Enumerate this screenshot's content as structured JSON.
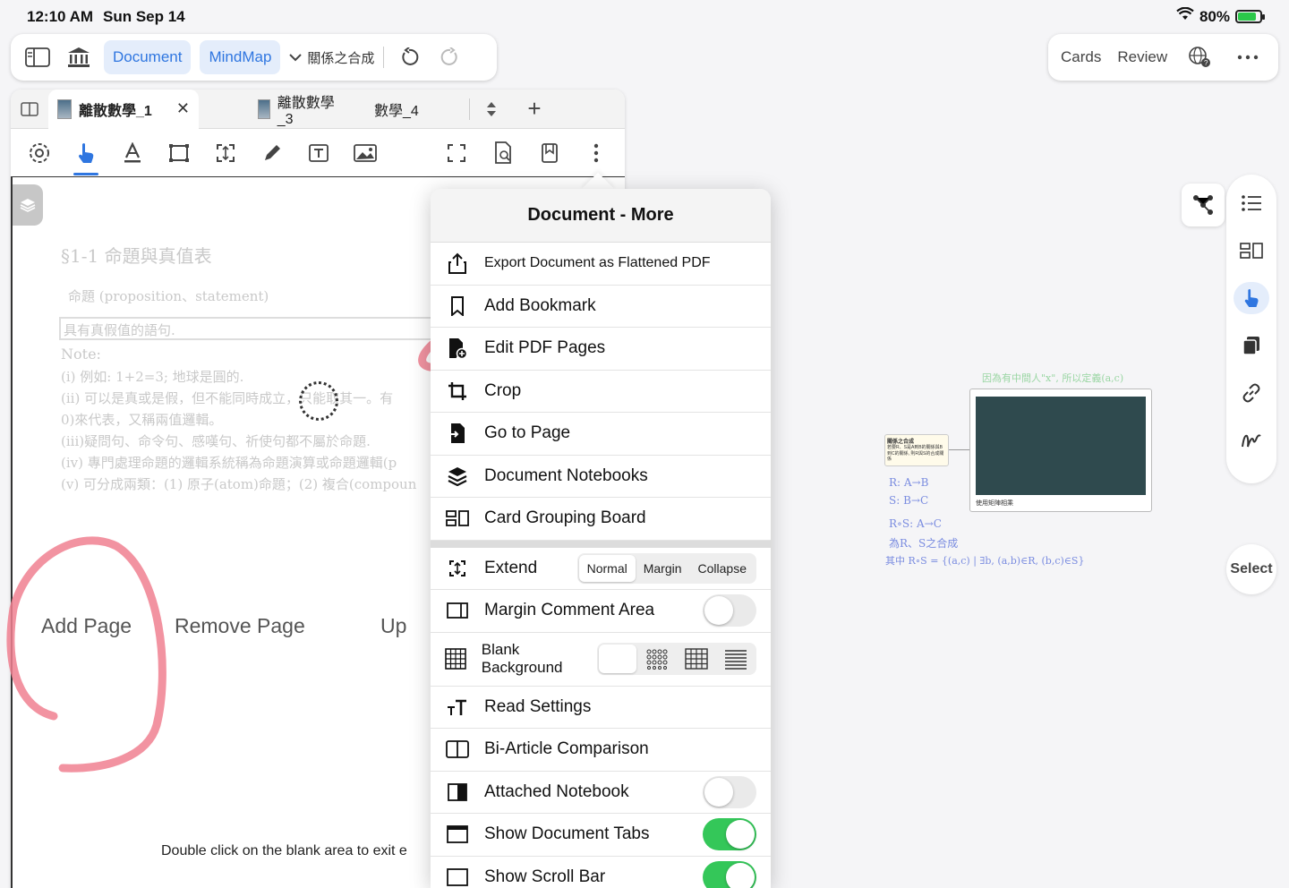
{
  "status": {
    "time": "12:10 AM",
    "date": "Sun Sep 14",
    "battery": "80%",
    "battery_level": 0.8
  },
  "topbar": {
    "document_label": "Document",
    "mindmap_label": "MindMap",
    "mindmap_title": "關係之合成",
    "cards_label": "Cards",
    "review_label": "Review"
  },
  "tabs": [
    {
      "label": "離散數學_1",
      "active": true
    },
    {
      "label": "離散數學_3",
      "active": false
    },
    {
      "label": "數學_4",
      "active": false
    }
  ],
  "page": {
    "heading": "§1-1  命題與真值表",
    "sub": "命題 (proposition、statement)",
    "definition": "具有真假值的語句.",
    "note": "Note:",
    "lines": [
      "(i)  例如: 1+2=3;  地球是圓的.",
      "(ii) 可以是真或是假，但不能同時成立，只能取其一。有",
      "     0)來代表，又稱兩值邏輯。",
      "(iii)疑問句、命令句、感嘆句、祈使句都不屬於命題.",
      "(iv) 專門處理命題的邏輯系統稱為命題演算或命題邏輯(p",
      "(v)  可分成兩類：(1) 原子(atom)命題；(2) 複合(compoun"
    ],
    "add_page": "Add Page",
    "remove_page": "Remove Page",
    "up": "Up",
    "hint": "Double click on the blank area to exit e"
  },
  "popover": {
    "title": "Document - More",
    "items": {
      "export": "Export Document as Flattened PDF",
      "bookmark": "Add Bookmark",
      "edit_pages": "Edit PDF Pages",
      "crop": "Crop",
      "goto": "Go to Page",
      "notebooks": "Document Notebooks",
      "grouping": "Card Grouping Board",
      "extend": "Extend",
      "margin_area": "Margin Comment Area",
      "blank_bg": "Blank Background",
      "read_settings": "Read Settings",
      "bi_article": "Bi-Article Comparison",
      "attached": "Attached Notebook",
      "show_tabs": "Show Document Tabs",
      "show_scroll": "Show Scroll Bar"
    },
    "extend_options": [
      "Normal",
      "Margin",
      "Collapse"
    ],
    "extend_selected": "Normal",
    "toggles": {
      "margin_area": false,
      "attached": false,
      "show_tabs": true,
      "show_scroll": true
    }
  },
  "mindmap": {
    "small_card_title": "關係之合成",
    "small_card_body": "若要R、S是A到B的關係與B到C的關係, 則R與S的合成關係",
    "big_card_caption": "使用矩陣相乘",
    "note_top": "因為有中間人\"x\", 所以定義(a,c)",
    "notes": [
      "R: A→B",
      "S: B→C",
      "R∘S: A→C",
      "為R、S之合成",
      "其中 R∘S = {(a,c) | ∃b, (a,b)∈R, (b,c)∈S}"
    ]
  },
  "side": {
    "select_label": "Select"
  },
  "colors": {
    "accent": "#2f76e0",
    "toggle_on": "#34c759",
    "ink": "#f08090"
  }
}
